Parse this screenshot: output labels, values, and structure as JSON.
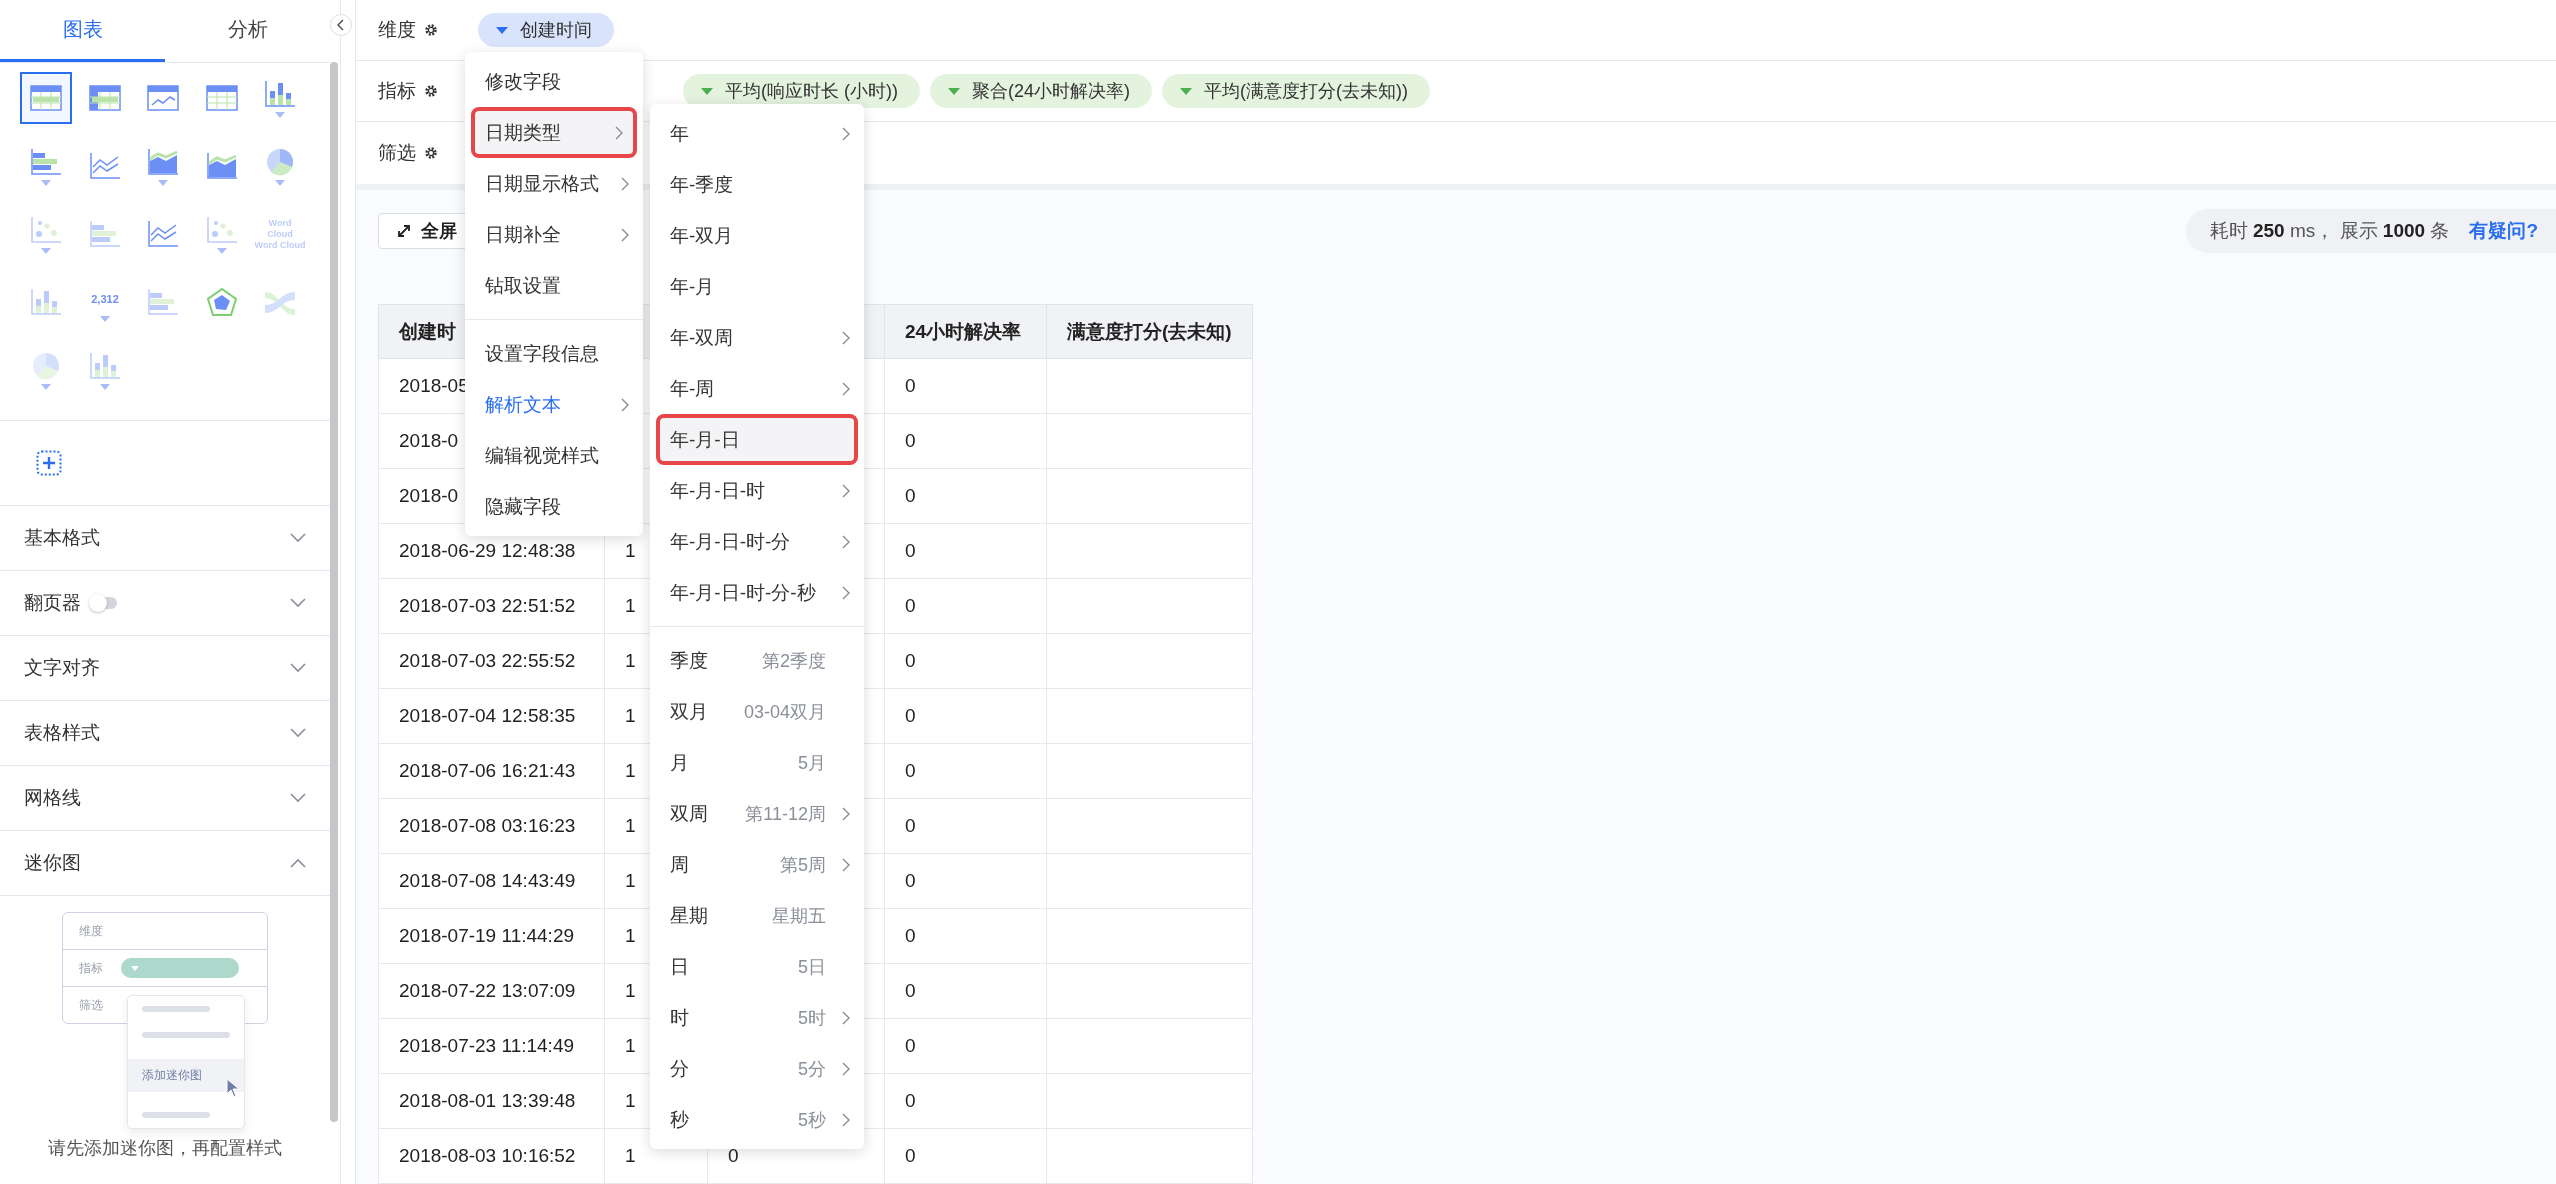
{
  "sidebar": {
    "tabs": [
      {
        "label": "图表",
        "selected": true
      },
      {
        "label": "分析",
        "selected": false
      }
    ],
    "chart_types": [
      {
        "kind": "table",
        "selected": true,
        "disabled": false,
        "dropdown": false
      },
      {
        "kind": "crosstab",
        "selected": false,
        "disabled": false,
        "dropdown": false
      },
      {
        "kind": "trend-table",
        "selected": false,
        "disabled": false,
        "dropdown": false
      },
      {
        "kind": "grid-table",
        "selected": false,
        "disabled": false,
        "dropdown": false
      },
      {
        "kind": "column",
        "selected": false,
        "disabled": false,
        "dropdown": true
      },
      {
        "kind": "bar",
        "selected": false,
        "disabled": false,
        "dropdown": true
      },
      {
        "kind": "line",
        "selected": false,
        "disabled": false,
        "dropdown": false
      },
      {
        "kind": "area",
        "selected": false,
        "disabled": false,
        "dropdown": true
      },
      {
        "kind": "combo",
        "selected": false,
        "disabled": false,
        "dropdown": false
      },
      {
        "kind": "pie",
        "selected": false,
        "disabled": false,
        "dropdown": true
      },
      {
        "kind": "map",
        "selected": false,
        "disabled": true,
        "dropdown": true
      },
      {
        "kind": "stack",
        "selected": false,
        "disabled": true,
        "dropdown": false
      },
      {
        "kind": "line-bar",
        "selected": false,
        "disabled": false,
        "dropdown": false
      },
      {
        "kind": "scatter",
        "selected": false,
        "disabled": true,
        "dropdown": true
      },
      {
        "kind": "wordcloud",
        "selected": false,
        "disabled": true,
        "dropdown": false,
        "icon_text": [
          "Word",
          "Cloud",
          "Word Cloud"
        ]
      },
      {
        "kind": "histogram",
        "selected": false,
        "disabled": true,
        "dropdown": false
      },
      {
        "kind": "kpi",
        "selected": false,
        "disabled": false,
        "dropdown": true,
        "icon_text": [
          "2,312"
        ]
      },
      {
        "kind": "funnel",
        "selected": false,
        "disabled": true,
        "dropdown": false
      },
      {
        "kind": "radar",
        "selected": false,
        "disabled": false,
        "dropdown": false
      },
      {
        "kind": "sankey",
        "selected": false,
        "disabled": true,
        "dropdown": false
      },
      {
        "kind": "gauge",
        "selected": false,
        "disabled": true,
        "dropdown": true
      },
      {
        "kind": "waterfall",
        "selected": false,
        "disabled": true,
        "dropdown": true
      }
    ],
    "sections": [
      {
        "title": "基本格式",
        "expanded": false
      },
      {
        "title": "翻页器",
        "expanded": false,
        "toggle_on": false
      },
      {
        "title": "文字对齐",
        "expanded": false
      },
      {
        "title": "表格样式",
        "expanded": false
      },
      {
        "title": "网格线",
        "expanded": false
      },
      {
        "title": "迷你图",
        "expanded": true
      }
    ],
    "mini_chart": {
      "rows": [
        "维度",
        "指标",
        "筛选"
      ],
      "menu_item": "添加迷你图",
      "hint": "请先添加迷你图，再配置样式"
    }
  },
  "shelves": [
    {
      "label": "维度",
      "pills": [
        {
          "label": "创建时间",
          "kind": "dimension",
          "expanded": true
        }
      ]
    },
    {
      "label": "指标",
      "pills": [
        {
          "label": "平均(响应时长 (小时))",
          "kind": "measure",
          "expanded": false
        },
        {
          "label": "聚合(24小时解决率)",
          "kind": "measure",
          "expanded": false
        },
        {
          "label": "平均(满意度打分(去未知))",
          "kind": "measure",
          "expanded": false
        }
      ]
    },
    {
      "label": "筛选"
    }
  ],
  "toolbar": {
    "fullscreen": "全屏",
    "stats": "耗时 **250** ms， 展示 **1000** 条",
    "help_link": "有疑问?"
  },
  "table": {
    "columns": [
      {
        "label": "创建时"
      },
      {},
      {},
      {
        "label": "24小时解决率"
      },
      {
        "label": "满意度打分(去未知)"
      }
    ],
    "rows": [
      [
        "2018-05",
        null,
        null,
        "0",
        null
      ],
      [
        "2018-0",
        null,
        null,
        "0",
        null
      ],
      [
        "2018-0",
        null,
        null,
        "0",
        null
      ],
      [
        "2018-06-29 12:48:38",
        "1",
        null,
        "0",
        null
      ],
      [
        "2018-07-03 22:51:52",
        "1",
        null,
        "0",
        null
      ],
      [
        "2018-07-03 22:55:52",
        "1",
        null,
        "0",
        null
      ],
      [
        "2018-07-04 12:58:35",
        "1",
        null,
        "0",
        null
      ],
      [
        "2018-07-06 16:21:43",
        "1",
        null,
        "0",
        null
      ],
      [
        "2018-07-08 03:16:23",
        "1",
        null,
        "0",
        null
      ],
      [
        "2018-07-08 14:43:49",
        "1",
        null,
        "0",
        null
      ],
      [
        "2018-07-19 11:44:29",
        "1",
        null,
        "0",
        null
      ],
      [
        "2018-07-22 13:07:09",
        "1",
        null,
        "0",
        null
      ],
      [
        "2018-07-23 11:14:49",
        "1",
        null,
        "0",
        null
      ],
      [
        "2018-08-01 13:39:48",
        "1",
        null,
        "0",
        null
      ],
      [
        "2018-08-03 10:16:52",
        "1",
        "0",
        "0",
        null
      ]
    ]
  },
  "field_menu": {
    "groups": [
      [
        {
          "label": "修改字段",
          "submenu": false,
          "selected": false,
          "highlighted": false
        },
        {
          "label": "日期类型",
          "submenu": true,
          "selected": true,
          "highlighted": false
        },
        {
          "label": "日期显示格式",
          "submenu": true,
          "selected": false,
          "highlighted": false
        },
        {
          "label": "日期补全",
          "submenu": true,
          "selected": false,
          "highlighted": false
        },
        {
          "label": "钻取设置",
          "submenu": false,
          "selected": false,
          "highlighted": false
        }
      ],
      [
        {
          "label": "设置字段信息",
          "submenu": false,
          "selected": false,
          "highlighted": false
        },
        {
          "label": "解析文本",
          "submenu": true,
          "selected": false,
          "highlighted": true
        },
        {
          "label": "编辑视觉样式",
          "submenu": false,
          "selected": false,
          "highlighted": false
        },
        {
          "label": "隐藏字段",
          "submenu": false,
          "selected": false,
          "highlighted": false
        }
      ]
    ]
  },
  "date_type_menu": {
    "groups": [
      [
        {
          "label": "年",
          "submenu": true,
          "selected": false
        },
        {
          "label": "年-季度",
          "submenu": false,
          "selected": false
        },
        {
          "label": "年-双月",
          "submenu": false,
          "selected": false
        },
        {
          "label": "年-月",
          "submenu": false,
          "selected": false
        },
        {
          "label": "年-双周",
          "submenu": true,
          "selected": false
        },
        {
          "label": "年-周",
          "submenu": true,
          "selected": false
        },
        {
          "label": "年-月-日",
          "submenu": false,
          "selected": true
        },
        {
          "label": "年-月-日-时",
          "submenu": true,
          "selected": false
        },
        {
          "label": "年-月-日-时-分",
          "submenu": true,
          "selected": false
        },
        {
          "label": "年-月-日-时-分-秒",
          "submenu": true,
          "selected": false
        }
      ],
      [
        {
          "label": "季度",
          "example": "第2季度",
          "submenu": false,
          "selected": false
        },
        {
          "label": "双月",
          "example": "03-04双月",
          "submenu": false,
          "selected": false
        },
        {
          "label": "月",
          "example": "5月",
          "submenu": false,
          "selected": false
        },
        {
          "label": "双周",
          "example": "第11-12周",
          "submenu": true,
          "selected": false
        },
        {
          "label": "周",
          "example": "第5周",
          "submenu": true,
          "selected": false
        },
        {
          "label": "星期",
          "example": "星期五",
          "submenu": false,
          "selected": false
        },
        {
          "label": "日",
          "example": "5日",
          "submenu": false,
          "selected": false
        },
        {
          "label": "时",
          "example": "5时",
          "submenu": true,
          "selected": false
        },
        {
          "label": "分",
          "example": "5分",
          "submenu": true,
          "selected": false
        },
        {
          "label": "秒",
          "example": "5秒",
          "submenu": true,
          "selected": false
        }
      ]
    ]
  }
}
